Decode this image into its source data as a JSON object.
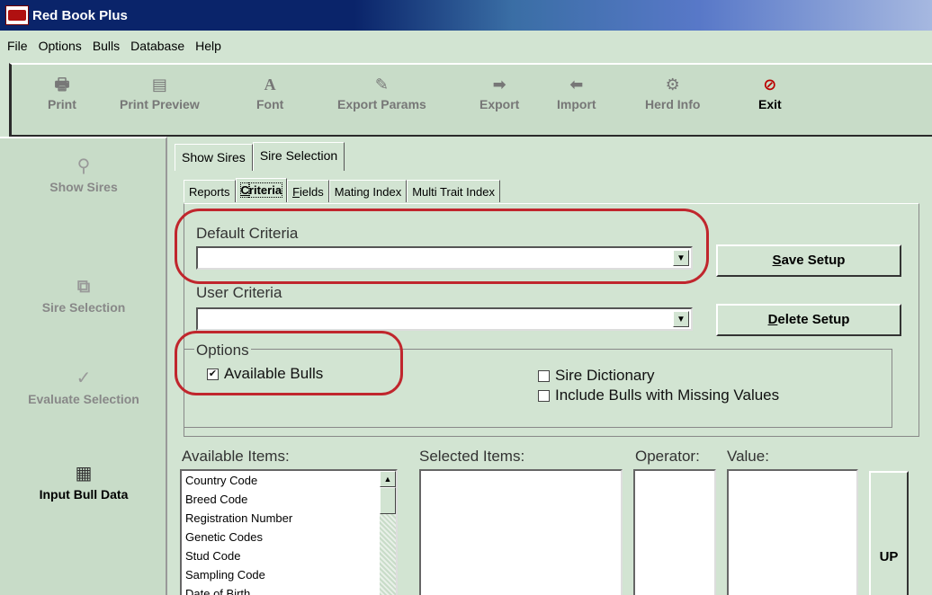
{
  "window": {
    "title": "Red Book Plus"
  },
  "menu": [
    "File",
    "Options",
    "Bulls",
    "Database",
    "Help"
  ],
  "toolbar": {
    "print": "Print",
    "print_preview": "Print Preview",
    "font": "Font",
    "export_params": "Export Params",
    "export": "Export",
    "import": "Import",
    "herd_info": "Herd Info",
    "exit": "Exit"
  },
  "sidebar": {
    "show_sires": "Show Sires",
    "sire_selection": "Sire Selection",
    "evaluate_selection": "Evaluate Selection",
    "input_bull_data": "Input Bull Data"
  },
  "tabs": {
    "show_sires": "Show Sires",
    "sire_selection": "Sire Selection"
  },
  "subtabs": {
    "reports": "Reports",
    "criteria_u": "C",
    "criteria_rest": "riteria",
    "fields_u": "F",
    "fields_rest": "ields",
    "mating_index": "Mating Index",
    "multi_trait_index": "Multi Trait Index"
  },
  "criteria": {
    "default_label": "Default Criteria",
    "default_value": "",
    "user_label": "User Criteria",
    "user_value": "",
    "save_u": "S",
    "save_rest": "ave Setup",
    "delete_u": "D",
    "delete_rest": "elete Setup"
  },
  "options": {
    "legend": "Options",
    "available_bulls": {
      "label": "Available Bulls",
      "checked": true,
      "mark": "✔"
    },
    "sire_dictionary": {
      "label": "Sire Dictionary",
      "checked": false
    },
    "include_missing": {
      "label": "Include Bulls with  Missing Values",
      "checked": false
    }
  },
  "lists": {
    "available_label": "Available Items:",
    "selected_label": "Selected Items:",
    "operator_label": "Operator:",
    "value_label": "Value:",
    "available_items": [
      "Country Code",
      "Breed Code",
      "Registration Number",
      "Genetic Codes",
      "Stud Code",
      "Sampling Code",
      "Date of Birth"
    ],
    "up_button": "UP"
  },
  "colors": {
    "accent": "#0a246a",
    "highlight": "#c0262d",
    "background": "#d2e4d2"
  }
}
